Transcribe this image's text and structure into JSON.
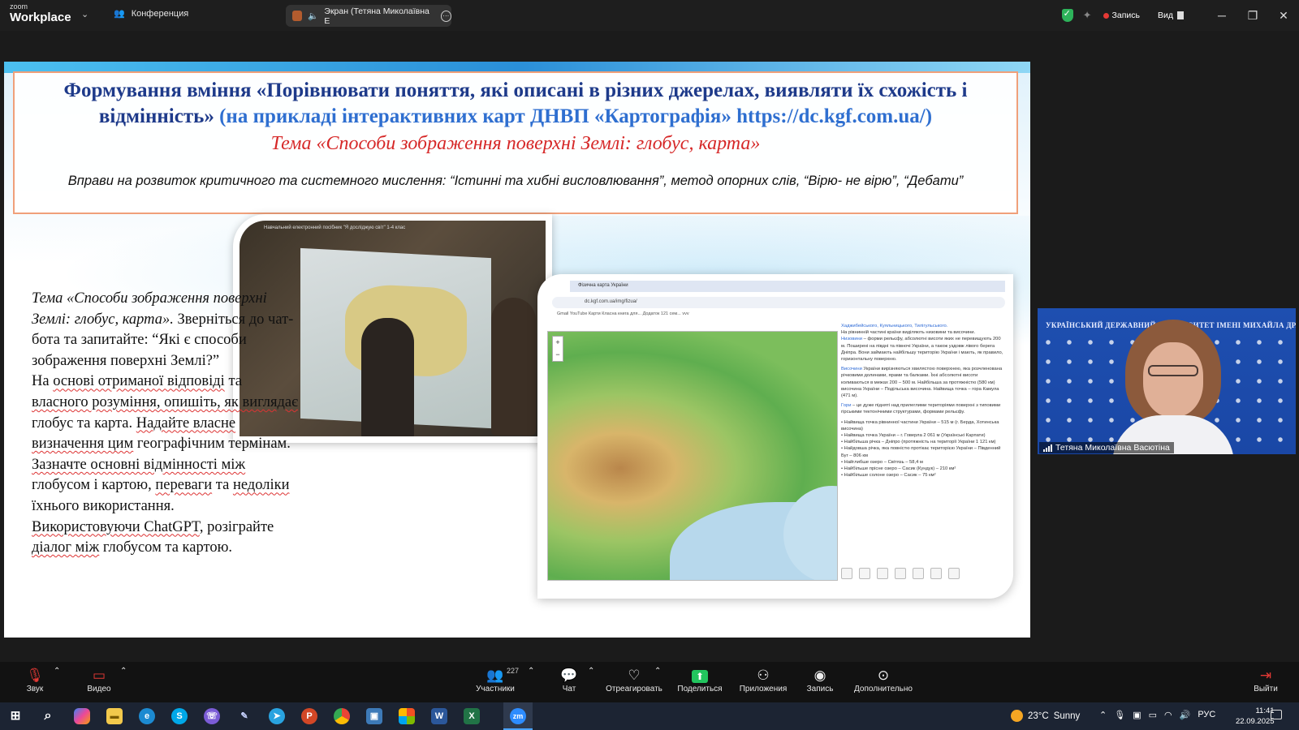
{
  "titlebar": {
    "brand_small": "zoom",
    "brand_big": "Workplace",
    "conference_tab": "Конференция",
    "screen_tab": "Экран (Тетяна Миколаївна Е",
    "record_label": "Запись",
    "view_label": "Вид"
  },
  "slide": {
    "title_part1": "Формування вміння «Порівнювати поняття, які описані в різних джерелах, виявляти їх схожість і відмінність»",
    "title_part2": "(на прикладі інтерактивних карт ДНВП «Картографія» https://dc.kgf.com.ua/)",
    "topic": "Тема «Способи зображення поверхні Землі: глобус, карта»",
    "exercises": "Вправи на розвиток критичного та системного мислення: “Істинні та хибні висловлювання”, метод опорних слів, “Вірю- не вірю”, “Дебати”",
    "photo_caption": "Навчальний електронний посібник \"Я досліджую світ\" 1-4 клас",
    "body_topic": "Тема «Способи зображення поверхні Землі: глобус, карта».",
    "body_1": "Зверніться до чат-бота та запитайте: “Які є способи зображення поверхні Землі?”",
    "body_2a": "На ",
    "body_2u1": "основі отриманої відповіді",
    "body_2b": " та ",
    "body_2u2": "власного розуміння, опишіть, як виглядає",
    "body_2c": " глобус та карта. ",
    "body_2u3": "Надайте власне визначення цим",
    "body_2d": " географічним термінам. ",
    "body_2u4": "Зазначте основні відмінності між",
    "body_2e": " глобусом і картою, ",
    "body_2u5": "переваги",
    "body_2f": " та ",
    "body_2u6": "недоліки",
    "body_2g": " їхнього використання.",
    "body_3u1": "Використовуючи ChatGPT",
    "body_3a": ", розіграйте ",
    "body_3u2": "діалог між",
    "body_3b": " глобусом та картою."
  },
  "browser": {
    "tab_title": "Фізична карта України",
    "url": "dc.kgf.com.ua/img/fizua/",
    "bookmarks": "Gmail   YouTube   Карти   Класна книга для...   Додаток 121 сем...   vvv",
    "text_p1_link": "Хаджибейського, Куяльницького, Тилігульського.",
    "text_p2": "На рівнинній частині країни виділяють низовини та височини.",
    "text_p2_link": "Низовини",
    "text_p2b": " – форми рельєфу, абсолютні висоти яких не перевищують 200 м. Поширені на півдні та півночі України, а також уздовж лівого берега Дніпра. Вони займають найбільшу територію України і мають, як правило, горизонтальну поверхню.",
    "text_p3_link": "Височини",
    "text_p3": " України вирізняються хвилястою поверхнею, яка розчленована річковими долинами, ярами та балками. Їхні абсолютні висоти коливаються в межах 200 – 500 м. Найбільша за протяжністю (580 км) височина України – Подільська височина. Найвища точка – гора Камула (471 м).",
    "text_p4_link": "Гори",
    "text_p4": " – це дуже підняті над прилеглими територіями поверхні з типовими гірськими тектонічними структурами, формами рельєфу.",
    "facts": [
      "• Найвища точка рівнинної частини України – 515 м (г. Берда, Хотинська височина)",
      "• Найвища точка України – г. Говерла 2 061 м (Українські Карпати)",
      "• Найбільша річка – Дніпро (протяжність на території України 1 121 км)",
      "• Найдовша річка, яка повністю протікає територією України – Південний Буг – 806 км",
      "• Найглибше озеро – Світязь – 58,4 м",
      "• Найбільше прісне озеро – Сасик (Кундук) – 210 км²",
      "• Найбільше солоне озеро – Сасик – 75 км²"
    ]
  },
  "speaker": {
    "banner": "УКРАЇНСЬКИЙ ДЕРЖАВНИЙ УНІВЕРСИТЕТ ІМЕНІ МИХАЙЛА ДРАГОМАНОВА",
    "name": "Тетяна Миколаївна Васютіна"
  },
  "controls": {
    "audio": "Звук",
    "video": "Видео",
    "participants": "Участники",
    "participants_count": "227",
    "chat": "Чат",
    "react": "Отреагировать",
    "share": "Поделиться",
    "apps": "Приложения",
    "record": "Запись",
    "more": "Дополнительно",
    "leave": "Выйти"
  },
  "taskbar": {
    "weather_temp": "23°C",
    "weather_text": "Sunny",
    "lang": "РУС",
    "time": "11:41",
    "date": "22.09.2025",
    "apps": [
      "Copilot",
      "Explorer",
      "Edge",
      "Skype",
      "Viber",
      "Feather",
      "Telegram",
      "PowerPoint",
      "Chrome",
      "Photos",
      "Store",
      "Word",
      "Excel",
      "Zoom"
    ]
  },
  "colors": {
    "title_blue": "#1e3a8a",
    "link_blue": "#2f6fd0",
    "topic_red": "#d62828",
    "record_red": "#e53935",
    "share_green": "#22c55e",
    "frame_orange": "#f0a07a"
  }
}
